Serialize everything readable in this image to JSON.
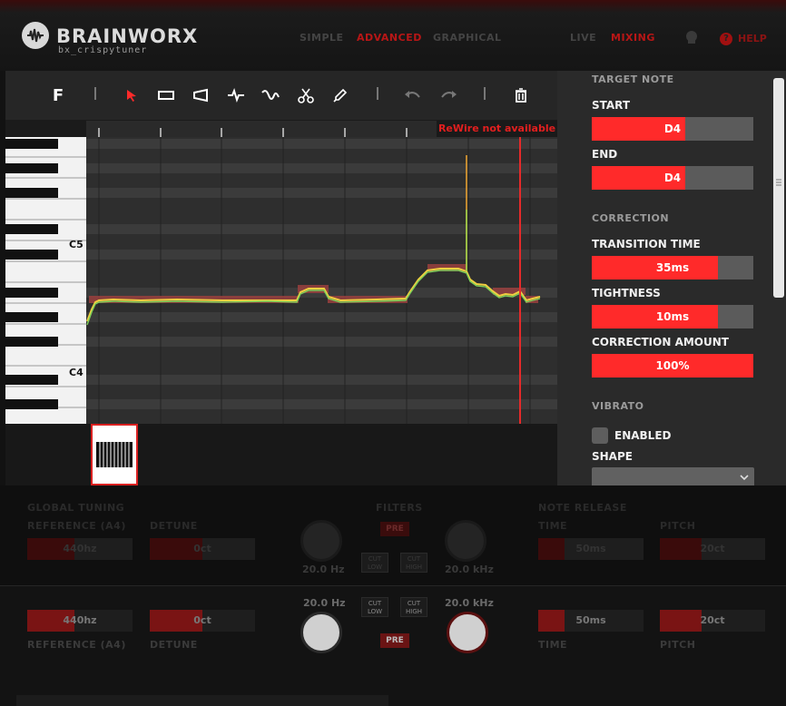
{
  "app": {
    "title": "BRAINWORX",
    "subtitle": "bx_crispytuner",
    "modes": [
      "SIMPLE",
      "ADVANCED",
      "GRAPHICAL"
    ],
    "active_mode": "ADVANCED",
    "play_modes": [
      "LIVE",
      "MIXING"
    ],
    "active_play_mode": "MIXING",
    "help_label": "HELP"
  },
  "toolbar": {
    "f_label": "F",
    "tools": [
      "select-arrow-icon",
      "rectangle-icon",
      "ramp-icon",
      "pitch-curve-icon",
      "vibrato-wave-icon",
      "scissors-icon",
      "pen-icon",
      "undo-icon",
      "redo-icon",
      "trash-icon"
    ],
    "active_tool": "select-arrow-icon"
  },
  "editor": {
    "rewire_status": "ReWire not available",
    "piano_labels": [
      "C5",
      "C4"
    ],
    "zoom_in": "+",
    "zoom_out": "-"
  },
  "panel": {
    "target_note": {
      "title": "TARGET NOTE",
      "start_label": "START",
      "start_value": "D4",
      "start_fill": 0.58,
      "end_label": "END",
      "end_value": "D4",
      "end_fill": 0.58
    },
    "correction": {
      "title": "CORRECTION",
      "transition_label": "TRANSITION TIME",
      "transition_value": "35ms",
      "transition_fill": 0.78,
      "tightness_label": "TIGHTNESS",
      "tightness_value": "10ms",
      "tightness_fill": 0.78,
      "amount_label": "CORRECTION AMOUNT",
      "amount_value": "100%",
      "amount_fill": 1.0
    },
    "vibrato": {
      "title": "VIBRATO",
      "enabled_label": "ENABLED",
      "enabled": false,
      "shape_label": "SHAPE",
      "shape_value": ""
    }
  },
  "bottom": {
    "global_tuning": "GLOBAL TUNING",
    "reference_label": "REFERENCE (A4)",
    "reference_value": "440hz",
    "detune_label": "DETUNE",
    "detune_value": "0ct",
    "filters_label": "FILTERS",
    "pre_label": "PRE",
    "low_freq": "20.0 Hz",
    "high_freq": "20.0 kHz",
    "cut_low": "CUT LOW",
    "cut_high": "CUT HIGH",
    "note_release": "NOTE RELEASE",
    "time_label": "TIME",
    "time_value": "50ms",
    "pitch_label": "PITCH",
    "pitch_value": "20ct"
  },
  "colors": {
    "accent": "#ff2a2a",
    "slider_bg": "#5b5b5b",
    "panel_bg": "#2a2a2a",
    "grid_bg": "#2e2e2e"
  }
}
